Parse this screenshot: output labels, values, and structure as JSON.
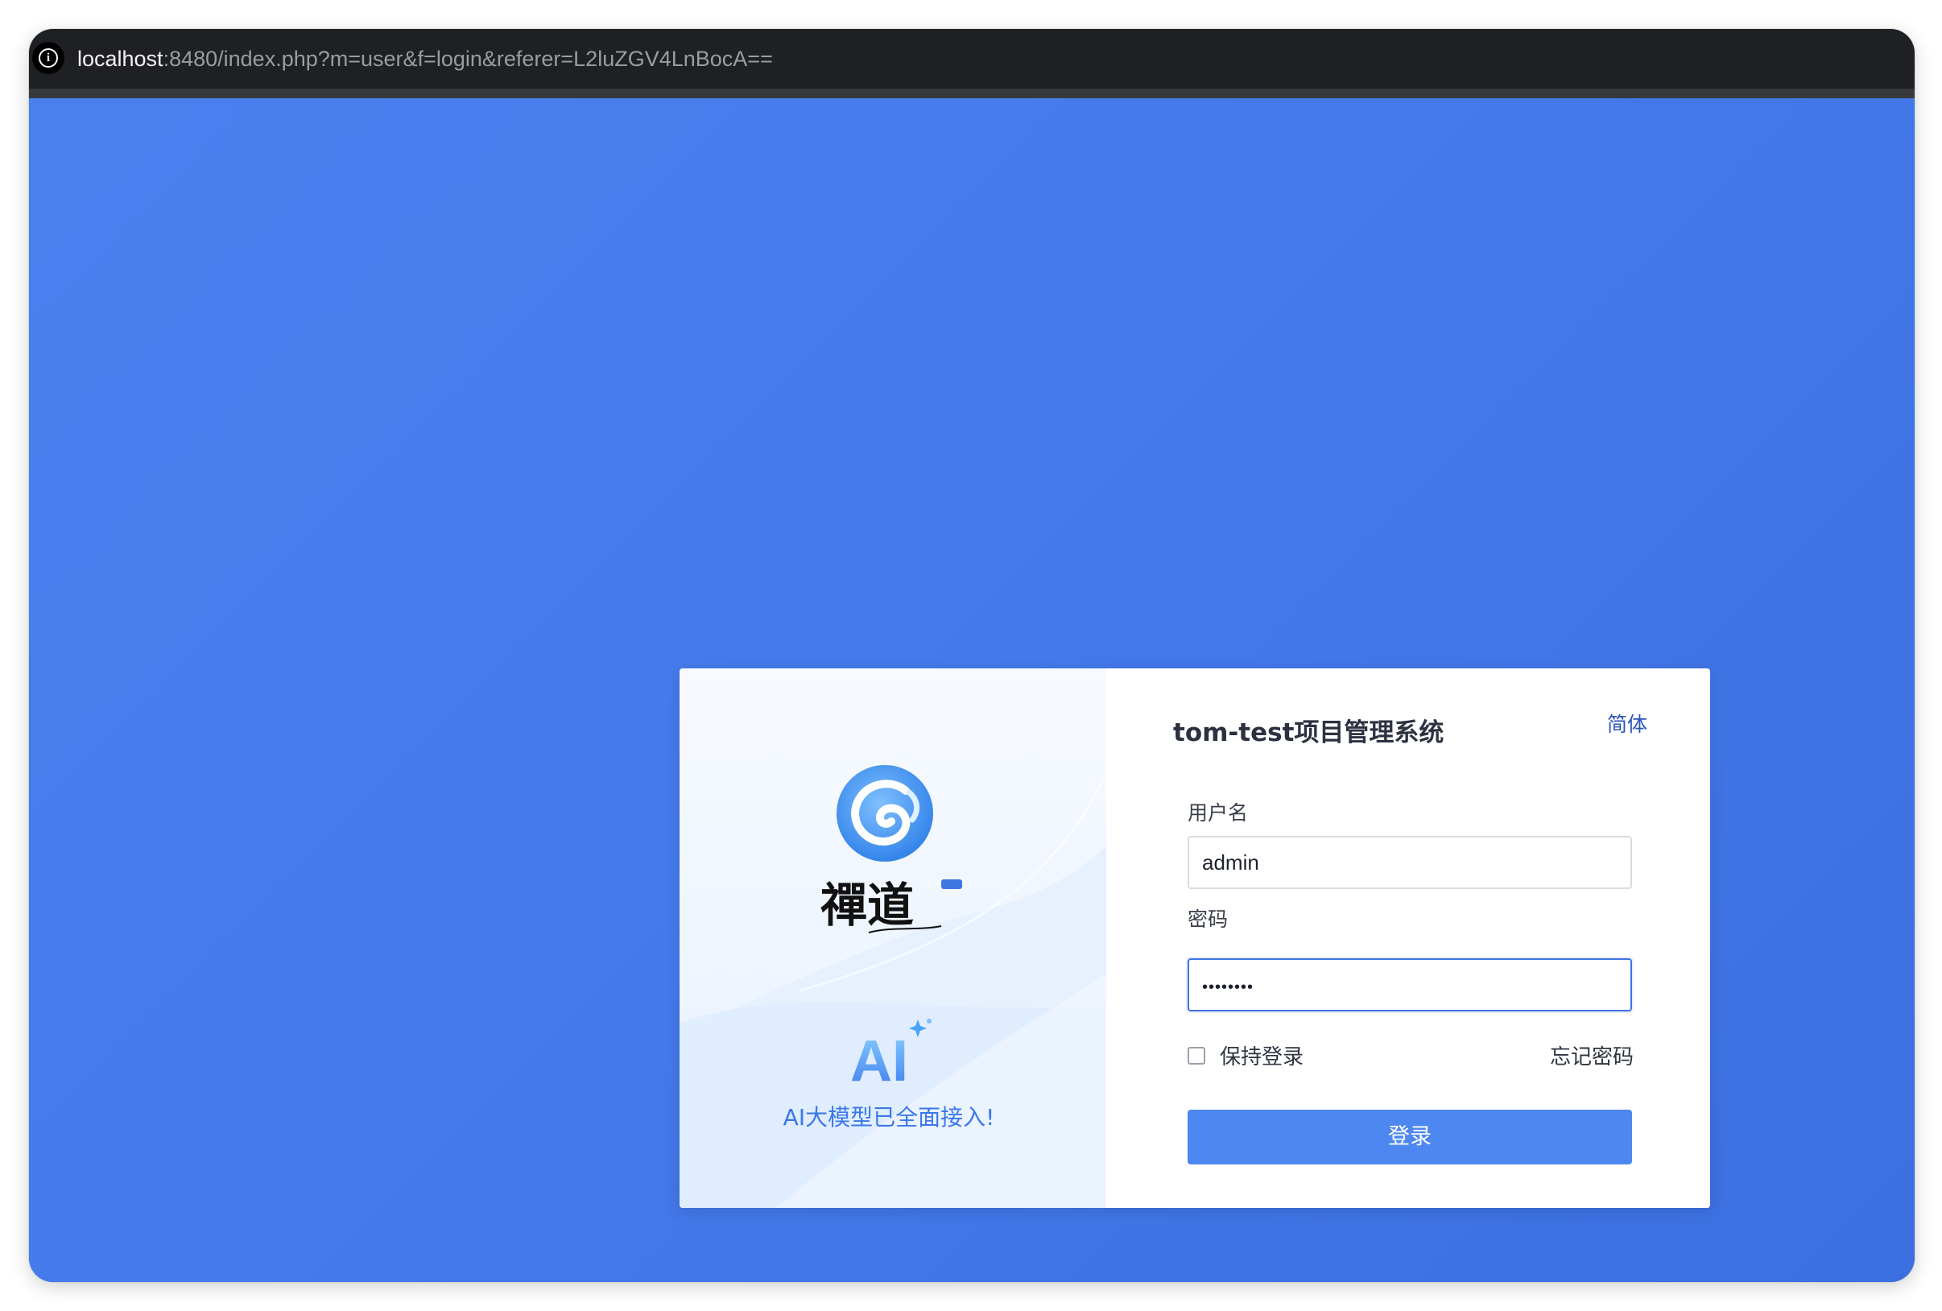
{
  "browser": {
    "url_host": "localhost",
    "url_path": ":8480/index.php?m=user&f=login&referer=L2luZGV4LnBocA=="
  },
  "login_card": {
    "brand_panel": {
      "logo_icon": "zentao-swirl-logo-icon",
      "brand_name": "禪道",
      "ai_mark": "AI",
      "tagline": "AI大模型已全面接入!"
    },
    "form": {
      "title": "tom-test项目管理系统",
      "language": "简体",
      "username_label": "用户名",
      "username_value": "admin",
      "password_label": "密码",
      "password_value": "••••••••",
      "remember_label": "保持登录",
      "remember_checked": false,
      "forgot_label": "忘记密码",
      "submit_label": "登录"
    }
  },
  "colors": {
    "page_background": "#4479ea",
    "primary_button": "#4d87f0",
    "tagline": "#3b78ec",
    "address_bar": "#1f2023"
  }
}
